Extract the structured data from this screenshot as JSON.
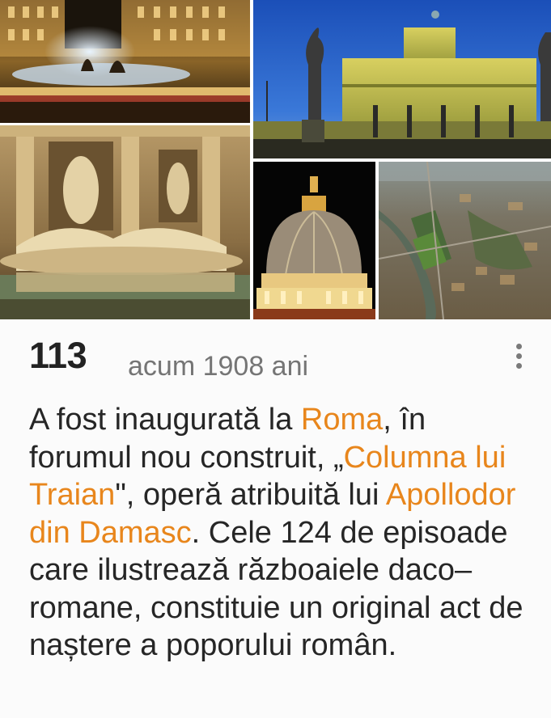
{
  "card": {
    "year": "113",
    "time_ago": "acum 1908 ani",
    "menu_icon": "more-vert-icon",
    "description": {
      "t1": "A fost inaugurată la ",
      "link1": "Roma",
      "t2": ", în forumul nou construit, „",
      "link2": "Columna lui Traian",
      "t3": "\", operă atribuită lui ",
      "link3": "Apollodor din Damasc",
      "t4": ". Cele 124 de episoade care ilustrează războaiele daco–romane, constituie un original act de naștere a poporului român."
    }
  },
  "colors": {
    "link": "#e8861c",
    "year": "#222222",
    "time_ago": "#757575",
    "body": "#262626"
  },
  "images": [
    {
      "name": "fountain-naiads-photo"
    },
    {
      "name": "trevi-fountain-photo"
    },
    {
      "name": "castel-sant-angelo-photo"
    },
    {
      "name": "st-peters-dome-photo"
    },
    {
      "name": "rome-aerial-photo"
    }
  ]
}
